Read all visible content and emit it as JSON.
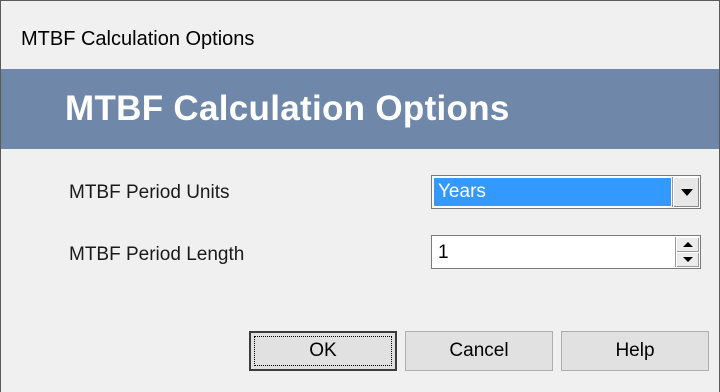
{
  "window": {
    "title": "MTBF Calculation Options"
  },
  "header": {
    "title": "MTBF Calculation Options"
  },
  "fields": {
    "period_units": {
      "label": "MTBF Period Units",
      "selected": "Years"
    },
    "period_length": {
      "label": "MTBF Period Length",
      "value": "1"
    }
  },
  "buttons": {
    "ok": "OK",
    "cancel": "Cancel",
    "help": "Help"
  },
  "colors": {
    "header_band": "#6f87a8",
    "selection": "#3399ff",
    "window_bg": "#f0f0f0"
  },
  "icons": {
    "combo_dropdown": "chevron-down-icon",
    "spin_up": "arrow-up-icon",
    "spin_down": "arrow-down-icon"
  }
}
